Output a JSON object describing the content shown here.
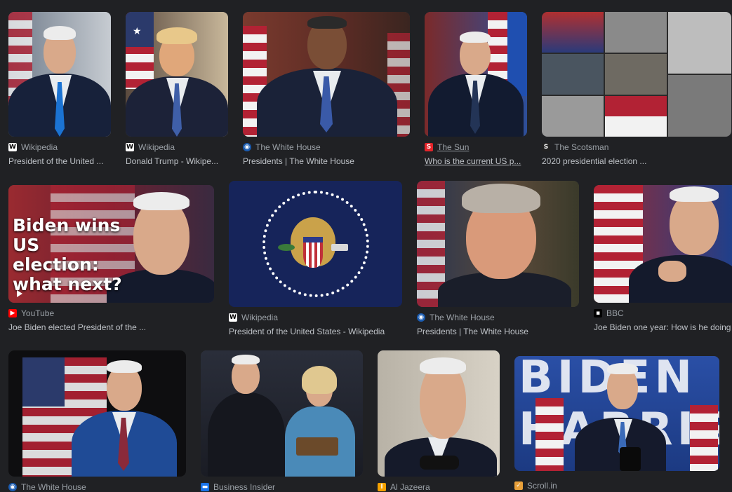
{
  "results": [
    {
      "source": "Wikipedia",
      "title": "President of the United ...",
      "favicon": "W"
    },
    {
      "source": "Wikipedia",
      "title": "Donald Trump - Wikipe...",
      "favicon": "W"
    },
    {
      "source": "The White House",
      "title": "Presidents | The White House",
      "favicon": "◉"
    },
    {
      "source": "The Sun",
      "title": "Who is the current US p...",
      "favicon": "S"
    },
    {
      "source": "The Scotsman",
      "title": "2020 presidential election ...",
      "favicon": "S"
    },
    {
      "source": "YouTube",
      "title": "Joe Biden elected President of the ...",
      "favicon": "▶",
      "overlay": "Biden wins US election: what next?"
    },
    {
      "source": "Wikipedia",
      "title": "President of the United States - Wikipedia",
      "favicon": "W"
    },
    {
      "source": "The White House",
      "title": "Presidents | The White House",
      "favicon": "◉"
    },
    {
      "source": "BBC",
      "title": "Joe Biden one year: How is he doing",
      "favicon": "▪"
    },
    {
      "source": "The White House",
      "title": "",
      "favicon": "◉"
    },
    {
      "source": "Business Insider",
      "title": "",
      "favicon": "▬"
    },
    {
      "source": "Al Jazeera",
      "title": "",
      "favicon": "ا"
    },
    {
      "source": "Scroll.in",
      "title": "",
      "favicon": "✓",
      "banner": "BIDEN HARRIS"
    }
  ],
  "colors": {
    "background": "#202124",
    "text": "#bdc1c6",
    "muted": "#9aa0a6"
  }
}
